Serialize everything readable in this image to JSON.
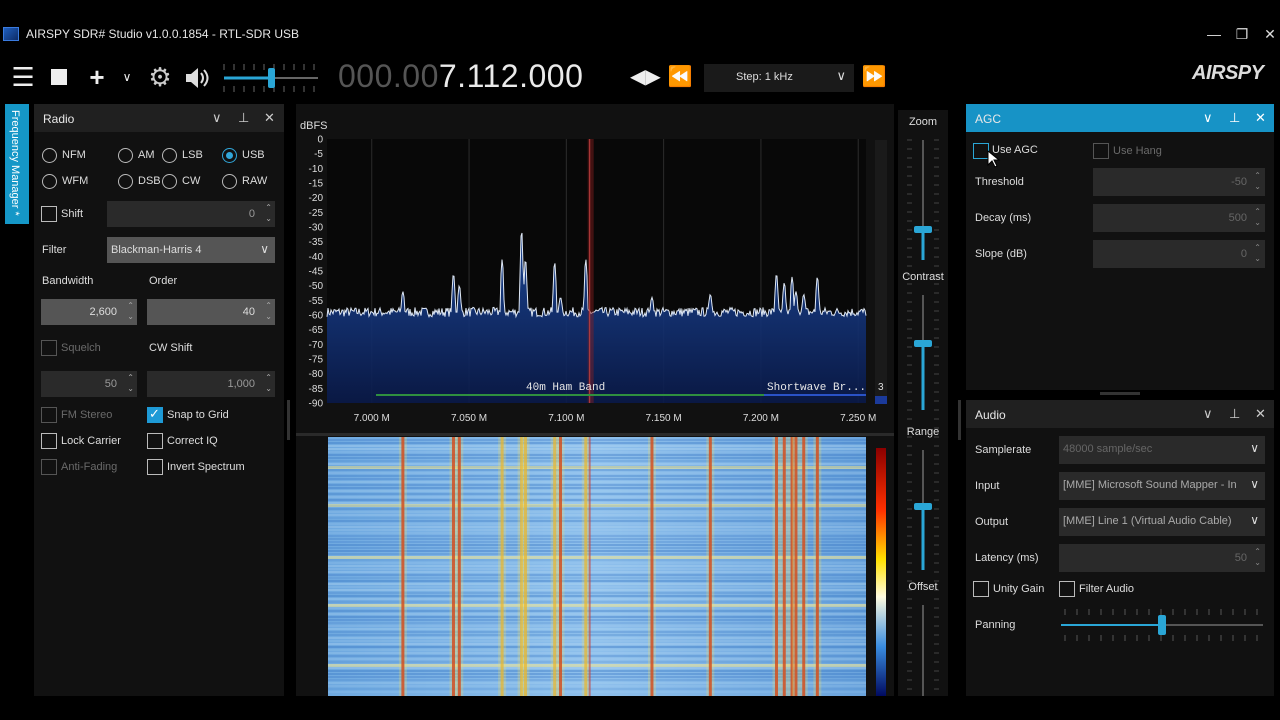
{
  "window": {
    "title": "AIRSPY SDR# Studio v1.0.0.1854 - RTL-SDR USB"
  },
  "toolbar": {
    "frequency_dim": "000.00",
    "frequency_lit": "7.112.000",
    "step_label": "Step: 1 kHz",
    "logo": "AIRSPY",
    "volume_level": 0.5
  },
  "sidetab": {
    "label": "Frequency Manager *"
  },
  "radio": {
    "title": "Radio",
    "modes": [
      {
        "label": "NFM",
        "selected": false
      },
      {
        "label": "AM",
        "selected": false
      },
      {
        "label": "LSB",
        "selected": false
      },
      {
        "label": "USB",
        "selected": true
      },
      {
        "label": "WFM",
        "selected": false
      },
      {
        "label": "DSB",
        "selected": false
      },
      {
        "label": "CW",
        "selected": false
      },
      {
        "label": "RAW",
        "selected": false
      }
    ],
    "shift_label": "Shift",
    "shift_value": "0",
    "filter_label": "Filter",
    "filter_value": "Blackman-Harris 4",
    "bandwidth_label": "Bandwidth",
    "bandwidth_value": "2,600",
    "order_label": "Order",
    "order_value": "40",
    "squelch_label": "Squelch",
    "squelch_value": "50",
    "cwshift_label": "CW Shift",
    "cwshift_value": "1,000",
    "fm_stereo_label": "FM Stereo",
    "snap_label": "Snap to Grid",
    "lock_carrier_label": "Lock Carrier",
    "correct_iq_label": "Correct IQ",
    "anti_fading_label": "Anti-Fading",
    "invert_label": "Invert Spectrum"
  },
  "spectrum": {
    "ylabel": "dBFS",
    "band1": "40m Ham Band",
    "band2": "Shortwave Br...",
    "side_number": "3"
  },
  "chart_data": {
    "type": "line",
    "ylabel": "dBFS",
    "ylim": [
      -90,
      0
    ],
    "yticks": [
      0,
      -5,
      -10,
      -15,
      -20,
      -25,
      -30,
      -35,
      -40,
      -45,
      -50,
      -55,
      -60,
      -65,
      -70,
      -75,
      -80,
      -85,
      -90
    ],
    "xlim": [
      6.977,
      7.254
    ],
    "xticks": [
      7.0,
      7.05,
      7.1,
      7.15,
      7.2,
      7.25
    ],
    "xtick_labels": [
      "7.000 M",
      "7.050 M",
      "7.100 M",
      "7.150 M",
      "7.200 M",
      "7.250 M"
    ],
    "noise_floor": -59,
    "peaks": [
      {
        "x": 7.016,
        "y": -52
      },
      {
        "x": 7.042,
        "y": -46
      },
      {
        "x": 7.045,
        "y": -50
      },
      {
        "x": 7.067,
        "y": -41
      },
      {
        "x": 7.077,
        "y": -31
      },
      {
        "x": 7.079,
        "y": -41
      },
      {
        "x": 7.094,
        "y": -42
      },
      {
        "x": 7.097,
        "y": -54
      },
      {
        "x": 7.11,
        "y": -41
      },
      {
        "x": 7.144,
        "y": -54
      },
      {
        "x": 7.174,
        "y": -53
      },
      {
        "x": 7.208,
        "y": -46
      },
      {
        "x": 7.212,
        "y": -49
      },
      {
        "x": 7.216,
        "y": -47
      },
      {
        "x": 7.218,
        "y": -52
      },
      {
        "x": 7.222,
        "y": -53
      },
      {
        "x": 7.229,
        "y": -47
      }
    ],
    "tuned_frequency": 7.112,
    "grid": true
  },
  "zoom": {
    "zoom_label": "Zoom",
    "contrast_label": "Contrast",
    "range_label": "Range",
    "offset_label": "Offset"
  },
  "agc": {
    "title": "AGC",
    "use_agc_label": "Use AGC",
    "use_hang_label": "Use Hang",
    "threshold_label": "Threshold",
    "threshold_value": "-50",
    "decay_label": "Decay (ms)",
    "decay_value": "500",
    "slope_label": "Slope (dB)",
    "slope_value": "0"
  },
  "audio": {
    "title": "Audio",
    "samplerate_label": "Samplerate",
    "samplerate_value": "48000 sample/sec",
    "input_label": "Input",
    "input_value": "[MME] Microsoft Sound Mapper - In",
    "output_label": "Output",
    "output_value": "[MME] Line 1 (Virtual Audio Cable)",
    "latency_label": "Latency (ms)",
    "latency_value": "50",
    "unity_gain_label": "Unity Gain",
    "filter_audio_label": "Filter Audio",
    "panning_label": "Panning",
    "panning_level": 0.5
  }
}
